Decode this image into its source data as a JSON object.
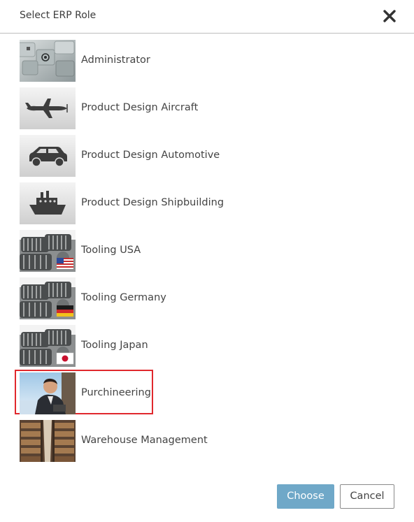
{
  "dialog": {
    "title": "Select ERP Role",
    "close_icon": "close-icon",
    "roles": [
      {
        "label": "Administrator",
        "icon": "administrator-keyboard-image"
      },
      {
        "label": "Product Design Aircraft",
        "icon": "aircraft-icon"
      },
      {
        "label": "Product Design Automotive",
        "icon": "car-icon"
      },
      {
        "label": "Product Design Shipbuilding",
        "icon": "ship-icon"
      },
      {
        "label": "Tooling USA",
        "icon": "tooling-usa-image"
      },
      {
        "label": "Tooling Germany",
        "icon": "tooling-germany-image"
      },
      {
        "label": "Tooling Japan",
        "icon": "tooling-japan-image"
      },
      {
        "label": "Purchineering",
        "icon": "purchineering-image",
        "selected": true
      },
      {
        "label": "Warehouse Management",
        "icon": "warehouse-image"
      }
    ],
    "buttons": {
      "choose_label": "Choose",
      "cancel_label": "Cancel"
    },
    "colors": {
      "accent": "#6fa8c8",
      "selection_border": "#e0282d",
      "divider": "#bdbdbd"
    }
  }
}
